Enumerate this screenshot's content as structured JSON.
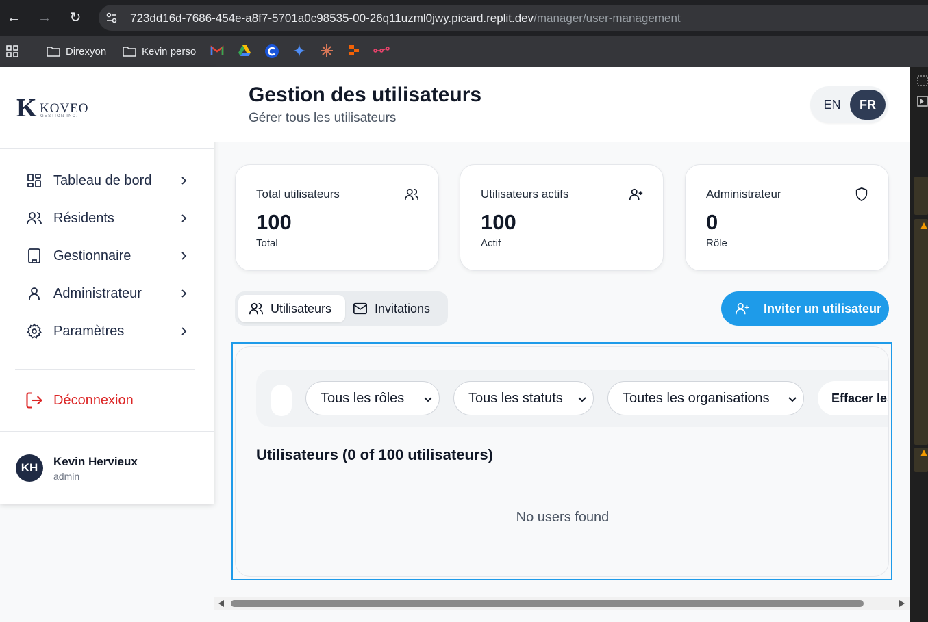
{
  "browser": {
    "url_host": "723dd16d-7686-454e-a8f7-5701a0c98535-00-26q11uzml0jwy.picard.replit.dev",
    "url_path": "/manager/user-management",
    "bookmarks": [
      {
        "label": "Direxyon",
        "icon": "folder-icon"
      },
      {
        "label": "Kevin perso",
        "icon": "folder-icon"
      }
    ]
  },
  "brand": {
    "logo_letter": "K",
    "logo_word": "KOVEO",
    "logo_sub": "GESTION INC."
  },
  "sidebar": {
    "items": [
      {
        "label": "Tableau de bord",
        "icon": "dashboard-icon"
      },
      {
        "label": "Résidents",
        "icon": "users-icon"
      },
      {
        "label": "Gestionnaire",
        "icon": "building-icon"
      },
      {
        "label": "Administrateur",
        "icon": "user-icon"
      },
      {
        "label": "Paramètres",
        "icon": "gear-icon"
      }
    ],
    "logout_label": "Déconnexion",
    "user": {
      "initials": "KH",
      "name": "Kevin Hervieux",
      "role": "admin"
    }
  },
  "header": {
    "title": "Gestion des utilisateurs",
    "subtitle": "Gérer tous les utilisateurs",
    "lang_en": "EN",
    "lang_fr": "FR",
    "active_lang": "FR"
  },
  "stats": [
    {
      "title": "Total utilisateurs",
      "value": "100",
      "sub": "Total",
      "icon": "users-icon"
    },
    {
      "title": "Utilisateurs actifs",
      "value": "100",
      "sub": "Actif",
      "icon": "user-plus-icon"
    },
    {
      "title": "Administrateur",
      "value": "0",
      "sub": "Rôle",
      "icon": "shield-icon"
    }
  ],
  "tabs": {
    "users_label": "Utilisateurs",
    "invitations_label": "Invitations",
    "active": "Utilisateurs"
  },
  "invite_button": "Inviter un utilisateur",
  "filters": {
    "roles": "Tous les rôles",
    "statuses": "Tous les statuts",
    "organizations": "Toutes les organisations",
    "clear": "Effacer les filt"
  },
  "users_panel": {
    "heading": "Utilisateurs (0 of 100 utilisateurs)",
    "empty": "No users found"
  },
  "colors": {
    "accent": "#1e9be9",
    "navy": "#1f2a44",
    "danger": "#dc2626"
  }
}
